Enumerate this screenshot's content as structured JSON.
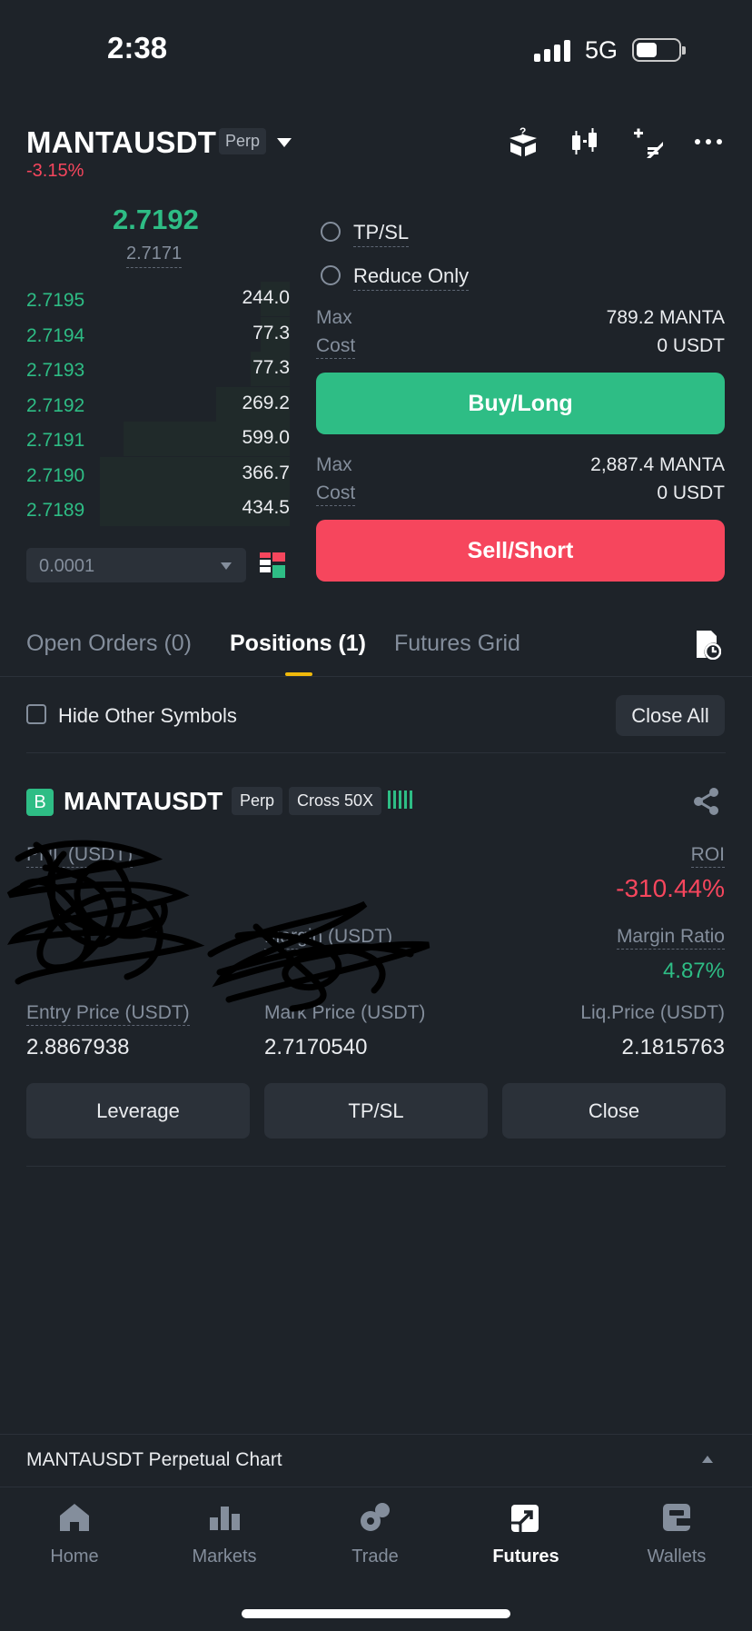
{
  "status_bar": {
    "time": "2:38",
    "network": "5G"
  },
  "header": {
    "symbol": "MANTAUSDT",
    "contract_type": "Perp",
    "change": "-3.15%"
  },
  "order_book": {
    "last_price": "2.7192",
    "mark_price": "2.7171",
    "rows": [
      {
        "price": "2.7195",
        "qty": "244.0",
        "depth": 0.11
      },
      {
        "price": "2.7194",
        "qty": "77.3",
        "depth": 0.11
      },
      {
        "price": "2.7193",
        "qty": "77.3",
        "depth": 0.15
      },
      {
        "price": "2.7192",
        "qty": "269.2",
        "depth": 0.28
      },
      {
        "price": "2.7191",
        "qty": "599.0",
        "depth": 0.63
      },
      {
        "price": "2.7190",
        "qty": "366.7",
        "depth": 0.72
      },
      {
        "price": "2.7189",
        "qty": "434.5",
        "depth": 0.72
      }
    ],
    "tick_size": "0.0001"
  },
  "order_form": {
    "tpsl_label": "TP/SL",
    "reduce_only_label": "Reduce Only",
    "max_label": "Max",
    "cost_label": "Cost",
    "buy_max": "789.2 MANTA",
    "buy_cost": "0 USDT",
    "buy_label": "Buy/Long",
    "sell_max": "2,887.4 MANTA",
    "sell_cost": "0 USDT",
    "sell_label": "Sell/Short"
  },
  "tabs": [
    {
      "label": "Open Orders (0)"
    },
    {
      "label": "Positions (1)"
    },
    {
      "label": "Futures Grid"
    }
  ],
  "positions": {
    "hide_label": "Hide Other Symbols",
    "close_all_label": "Close All",
    "item": {
      "side_badge": "B",
      "symbol": "MANTAUSDT",
      "contract_type": "Perp",
      "margin_mode": "Cross 50X",
      "pnl_label": "PNL (USDT)",
      "roi_label": "ROI",
      "roi_value": "-310.44%",
      "margin_label": "Margin (USDT)",
      "margin_ratio_label": "Margin Ratio",
      "margin_ratio_value": "4.87%",
      "entry_label": "Entry Price (USDT)",
      "entry_value": "2.8867938",
      "mark_label": "Mark Price (USDT)",
      "mark_value": "2.7170540",
      "liq_label": "Liq.Price (USDT)",
      "liq_value": "2.1815763",
      "leverage_btn": "Leverage",
      "tpsl_btn": "TP/SL",
      "close_btn": "Close"
    }
  },
  "chart_bar": {
    "label": "MANTAUSDT Perpetual  Chart"
  },
  "nav": [
    {
      "label": "Home",
      "icon": "home-icon"
    },
    {
      "label": "Markets",
      "icon": "markets-icon"
    },
    {
      "label": "Trade",
      "icon": "trade-icon"
    },
    {
      "label": "Futures",
      "icon": "futures-icon",
      "active": true
    },
    {
      "label": "Wallets",
      "icon": "wallet-icon"
    }
  ],
  "colors": {
    "background": "#1e2329",
    "green": "#2ebd85",
    "red": "#f6465d",
    "accent": "#f0b90b",
    "muted": "#848e9c"
  }
}
